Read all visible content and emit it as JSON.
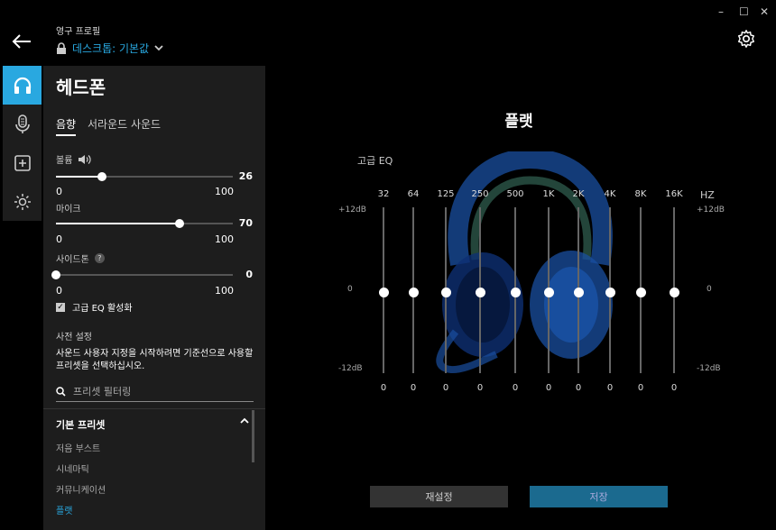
{
  "header": {
    "profile_label": "영구 프로필",
    "profile_value": "데스크톱: 기본값"
  },
  "window_controls": {
    "minimize": "–",
    "maximize": "☐",
    "close": "✕"
  },
  "sidebar": {
    "items": [
      {
        "name": "headphones",
        "active": true
      },
      {
        "name": "microphone",
        "active": false
      },
      {
        "name": "add",
        "active": false
      },
      {
        "name": "lighting",
        "active": false
      }
    ]
  },
  "panel": {
    "title": "헤드폰",
    "tabs": [
      {
        "label": "음향",
        "active": true
      },
      {
        "label": "서라운드 사운드",
        "active": false
      }
    ],
    "sliders": [
      {
        "label": "볼륨",
        "value": "26",
        "min": "0",
        "max": "100",
        "fraction": 0.26
      },
      {
        "label": "마이크",
        "value": "70",
        "min": "0",
        "max": "100",
        "fraction": 0.7
      },
      {
        "label": "사이드톤",
        "value": "0",
        "min": "0",
        "max": "100",
        "fraction": 0.0,
        "help": "?"
      }
    ],
    "advanced_eq_label": "고급 EQ 활성화",
    "advanced_eq_checked": true,
    "presets_heading": "사전 설정",
    "presets_description": "사운드 사용자 지정을 시작하려면 기준선으로 사용할 프리셋을 선택하십시오.",
    "filter_placeholder": "프리셋 필터링",
    "group_title": "기본 프리셋",
    "preset_items": [
      {
        "label": "저음 부스트",
        "selected": false
      },
      {
        "label": "시네마틱",
        "selected": false
      },
      {
        "label": "커뮤니케이션",
        "selected": false
      },
      {
        "label": "플랫",
        "selected": true
      }
    ]
  },
  "main": {
    "title": "플랫",
    "eq_title": "고급 EQ",
    "hz_label": "HZ",
    "db_top": "+12dB",
    "db_mid": "0",
    "db_bottom": "-12dB",
    "bands": [
      {
        "freq": "32",
        "value": "0",
        "gain": 0
      },
      {
        "freq": "64",
        "value": "0",
        "gain": 0
      },
      {
        "freq": "125",
        "value": "0",
        "gain": 0
      },
      {
        "freq": "250",
        "value": "0",
        "gain": 0
      },
      {
        "freq": "500",
        "value": "0",
        "gain": 0
      },
      {
        "freq": "1K",
        "value": "0",
        "gain": 0
      },
      {
        "freq": "2K",
        "value": "0",
        "gain": 0
      },
      {
        "freq": "4K",
        "value": "0",
        "gain": 0
      },
      {
        "freq": "8K",
        "value": "0",
        "gain": 0
      },
      {
        "freq": "16K",
        "value": "0",
        "gain": 0
      }
    ],
    "reset_label": "재설정",
    "save_label": "저장"
  },
  "colors": {
    "accent": "#29a8e0",
    "panel": "#1d1d1d",
    "save_button": "#1b6a8f",
    "headset": "#1a4fa0"
  }
}
